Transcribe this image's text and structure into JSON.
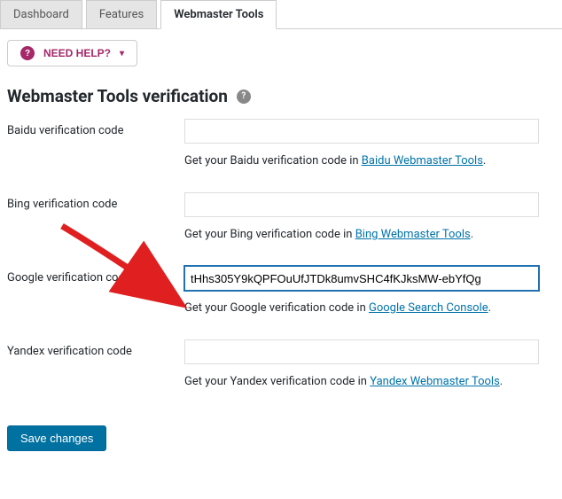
{
  "tabs": {
    "dashboard": "Dashboard",
    "features": "Features",
    "webmaster": "Webmaster Tools"
  },
  "help": {
    "label": "NEED HELP?"
  },
  "heading": "Webmaster Tools verification",
  "fields": {
    "baidu": {
      "label": "Baidu verification code",
      "value": "",
      "desc_prefix": "Get your Baidu verification code in ",
      "desc_link": "Baidu Webmaster Tools",
      "desc_suffix": "."
    },
    "bing": {
      "label": "Bing verification code",
      "value": "",
      "desc_prefix": "Get your Bing verification code in ",
      "desc_link": "Bing Webmaster Tools",
      "desc_suffix": "."
    },
    "google": {
      "label": "Google verification code",
      "value": "tHhs305Y9kQPFOuUfJTDk8umvSHC4fKJksMW-ebYfQg",
      "desc_prefix": "Get your Google verification code in ",
      "desc_link": "Google Search Console",
      "desc_suffix": "."
    },
    "yandex": {
      "label": "Yandex verification code",
      "value": "",
      "desc_prefix": "Get your Yandex verification code in ",
      "desc_link": "Yandex Webmaster Tools",
      "desc_suffix": "."
    }
  },
  "save_label": "Save changes"
}
